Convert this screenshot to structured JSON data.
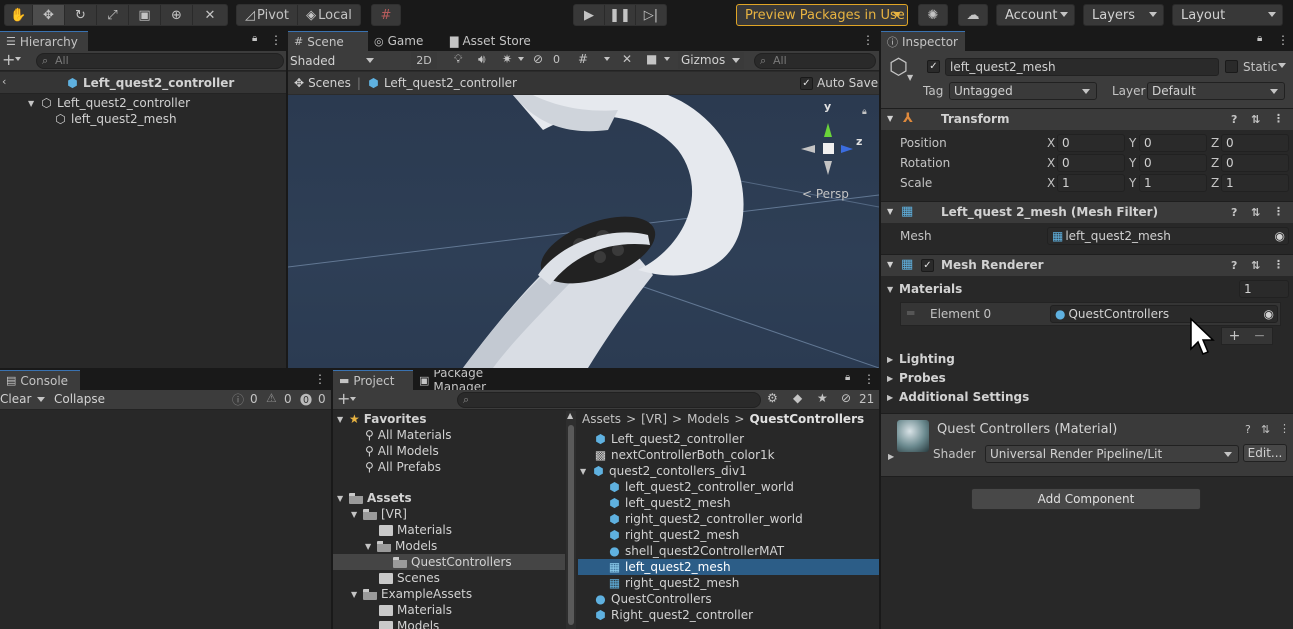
{
  "toolbar": {
    "pivot": "Pivot",
    "local": "Local",
    "preview_packages": "Preview Packages in Use",
    "account": "Account",
    "layers": "Layers",
    "layout": "Layout",
    "accent": "#e0a526"
  },
  "hierarchy": {
    "tab": "Hierarchy",
    "search_placeholder": "All",
    "scene_title": "Left_quest2_controller",
    "items": [
      {
        "label": "Left_quest2_controller"
      },
      {
        "label": "left_quest2_mesh"
      }
    ]
  },
  "scene": {
    "tabs": [
      "Scene",
      "Game",
      "Asset Store"
    ],
    "shading": "Shaded",
    "mode_2d": "2D",
    "hidden_count": "0",
    "gizmos": "Gizmos",
    "search_placeholder": "All",
    "breadcrumb_root": "Scenes",
    "breadcrumb_current": "Left_quest2_controller",
    "auto_save": "Auto Save",
    "persp": "Persp",
    "axis_y": "y",
    "axis_z": "z"
  },
  "console": {
    "tab": "Console",
    "clear": "Clear",
    "collapse": "Collapse",
    "info_count": "0",
    "warn_count": "0",
    "err_count": "0"
  },
  "project": {
    "tabs": [
      "Project",
      "Package Manager"
    ],
    "badge_count": "21",
    "favorites": "Favorites",
    "fav_items": [
      "All Materials",
      "All Models",
      "All Prefabs"
    ],
    "assets": "Assets",
    "tree": [
      "[VR]",
      "Materials",
      "Models",
      "QuestControllers",
      "Scenes",
      "ExampleAssets",
      "Materials",
      "Models"
    ],
    "breadcrumb": [
      "Assets",
      "[VR]",
      "Models",
      "QuestControllers"
    ],
    "files": [
      "Left_quest2_controller",
      "nextControllerBoth_color1k",
      "quest2_contollers_div1",
      "left_quest2_controller_world",
      "left_quest2_mesh",
      "right_quest2_controller_world",
      "right_quest2_mesh",
      "shell_quest2ControllerMAT",
      "left_quest2_mesh",
      "right_quest2_mesh",
      "QuestControllers",
      "Right_quest2_controller"
    ]
  },
  "inspector": {
    "tab": "Inspector",
    "object_name": "left_quest2_mesh",
    "static": "Static",
    "tag_label": "Tag",
    "tag_value": "Untagged",
    "layer_label": "Layer",
    "layer_value": "Default",
    "transform": {
      "title": "Transform",
      "position": "Position",
      "rotation": "Rotation",
      "scale": "Scale",
      "x": "X",
      "y": "Y",
      "z": "Z",
      "pos": [
        "0",
        "0",
        "0"
      ],
      "rot": [
        "0",
        "0",
        "0"
      ],
      "scl": [
        "1",
        "1",
        "1"
      ]
    },
    "mesh_filter": {
      "title": "Left_quest 2_mesh (Mesh Filter)",
      "mesh_label": "Mesh",
      "mesh_value": "left_quest2_mesh"
    },
    "mesh_renderer": {
      "title": "Mesh Renderer",
      "materials": "Materials",
      "materials_count": "1",
      "element0": "Element 0",
      "element0_value": "QuestControllers",
      "lighting": "Lighting",
      "probes": "Probes",
      "additional": "Additional Settings"
    },
    "material": {
      "title": "Quest Controllers (Material)",
      "shader_label": "Shader",
      "shader_value": "Universal Render Pipeline/Lit",
      "edit": "Edit..."
    },
    "add_component": "Add Component"
  }
}
